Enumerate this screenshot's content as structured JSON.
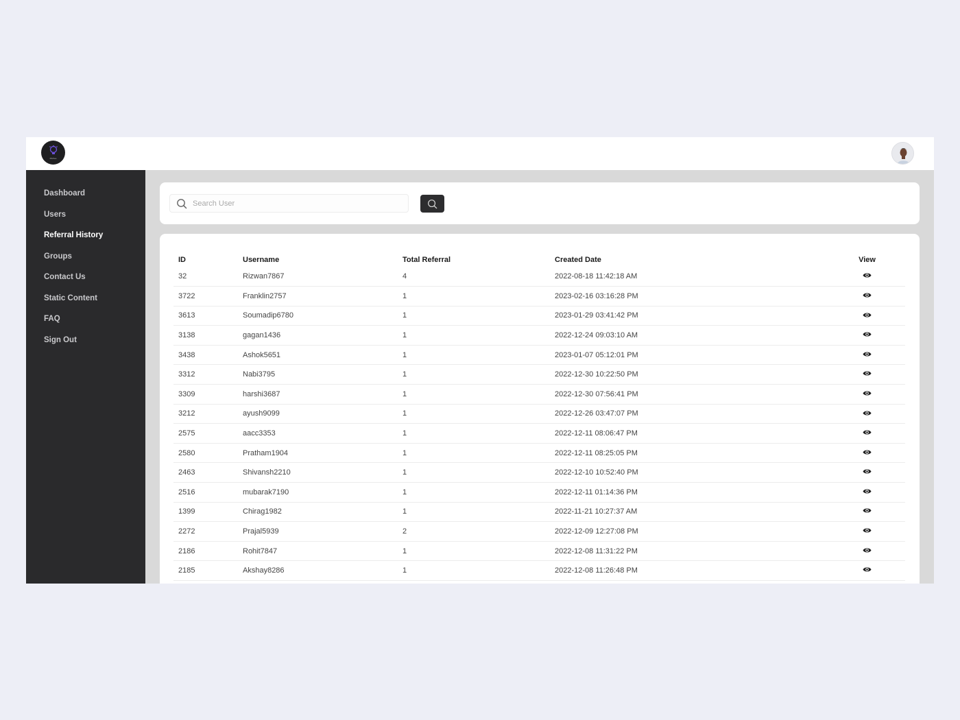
{
  "topbar": {
    "logo_icon": "lightbulb-logo-icon",
    "logo_text": "Pitches",
    "avatar_icon": "user-avatar-icon",
    "avatar_bg": "#e9eaee"
  },
  "sidebar": {
    "items": [
      {
        "label": "Dashboard",
        "active": false
      },
      {
        "label": "Users",
        "active": false
      },
      {
        "label": "Referral History",
        "active": true
      },
      {
        "label": "Groups",
        "active": false
      },
      {
        "label": "Contact Us",
        "active": false
      },
      {
        "label": "Static Content",
        "active": false
      },
      {
        "label": "FAQ",
        "active": false
      },
      {
        "label": "Sign Out",
        "active": false
      }
    ]
  },
  "search": {
    "placeholder": "Search User",
    "value": "",
    "icon": "search-icon",
    "button_icon": "search-icon"
  },
  "table": {
    "headers": {
      "id": "ID",
      "username": "Username",
      "total": "Total Referral",
      "date": "Created Date",
      "view": "View"
    },
    "view_icon": "eye-icon",
    "rows": [
      {
        "id": "32",
        "username": "Rizwan7867",
        "total": "4",
        "date": "2022-08-18 11:42:18 AM"
      },
      {
        "id": "3722",
        "username": "Franklin2757",
        "total": "1",
        "date": "2023-02-16 03:16:28 PM"
      },
      {
        "id": "3613",
        "username": "Soumadip6780",
        "total": "1",
        "date": "2023-01-29 03:41:42 PM"
      },
      {
        "id": "3138",
        "username": "gagan1436",
        "total": "1",
        "date": "2022-12-24 09:03:10 AM"
      },
      {
        "id": "3438",
        "username": "Ashok5651",
        "total": "1",
        "date": "2023-01-07 05:12:01 PM"
      },
      {
        "id": "3312",
        "username": "Nabi3795",
        "total": "1",
        "date": "2022-12-30 10:22:50 PM"
      },
      {
        "id": "3309",
        "username": "harshi3687",
        "total": "1",
        "date": "2022-12-30 07:56:41 PM"
      },
      {
        "id": "3212",
        "username": "ayush9099",
        "total": "1",
        "date": "2022-12-26 03:47:07 PM"
      },
      {
        "id": "2575",
        "username": "aacc3353",
        "total": "1",
        "date": "2022-12-11 08:06:47 PM"
      },
      {
        "id": "2580",
        "username": "Pratham1904",
        "total": "1",
        "date": "2022-12-11 08:25:05 PM"
      },
      {
        "id": "2463",
        "username": "Shivansh2210",
        "total": "1",
        "date": "2022-12-10 10:52:40 PM"
      },
      {
        "id": "2516",
        "username": "mubarak7190",
        "total": "1",
        "date": "2022-12-11 01:14:36 PM"
      },
      {
        "id": "1399",
        "username": "Chirag1982",
        "total": "1",
        "date": "2022-11-21 10:27:37 AM"
      },
      {
        "id": "2272",
        "username": "Prajal5939",
        "total": "2",
        "date": "2022-12-09 12:27:08 PM"
      },
      {
        "id": "2186",
        "username": "Rohit7847",
        "total": "1",
        "date": "2022-12-08 11:31:22 PM"
      },
      {
        "id": "2185",
        "username": "Akshay8286",
        "total": "1",
        "date": "2022-12-08 11:26:48 PM"
      }
    ]
  }
}
